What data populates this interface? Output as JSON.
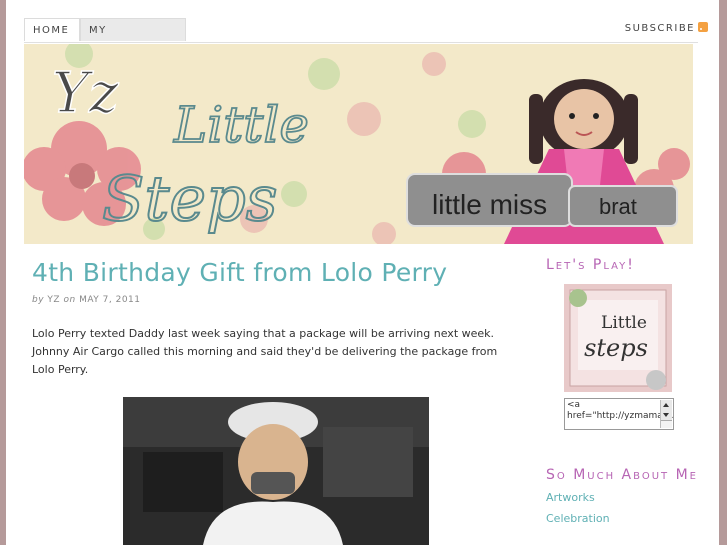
{
  "nav": {
    "home": "HOME",
    "playmates": "MY PLAYMATES",
    "subscribe": "SUBSCRIBE"
  },
  "banner": {
    "title_line1": "Yz",
    "title_line2": "Little",
    "title_line3": "Steps",
    "tag1": "little miss",
    "tag2": "brat"
  },
  "post": {
    "title": "4th Birthday Gift from Lolo Perry",
    "by": "by",
    "author": "YZ",
    "on": "on",
    "date": "MAY 7, 2011",
    "body": "Lolo Perry texted Daddy last week saying that a package will be arriving next week. Johnny Air Cargo called this morning and said they'd be delivering the package from Lolo Perry."
  },
  "sidebar": {
    "widget1_title": "Let's Play!",
    "badge_text1": "Little",
    "badge_text2": "steps",
    "code_text": "<a href=\"http://yzmamaril.com/\"",
    "widget2_title": "So Much About Me",
    "links": [
      "Artworks",
      "Celebration"
    ]
  },
  "colors": {
    "accent": "#5fb0b4",
    "sidebar_title": "#b765b4",
    "background": "#b59a9a"
  }
}
